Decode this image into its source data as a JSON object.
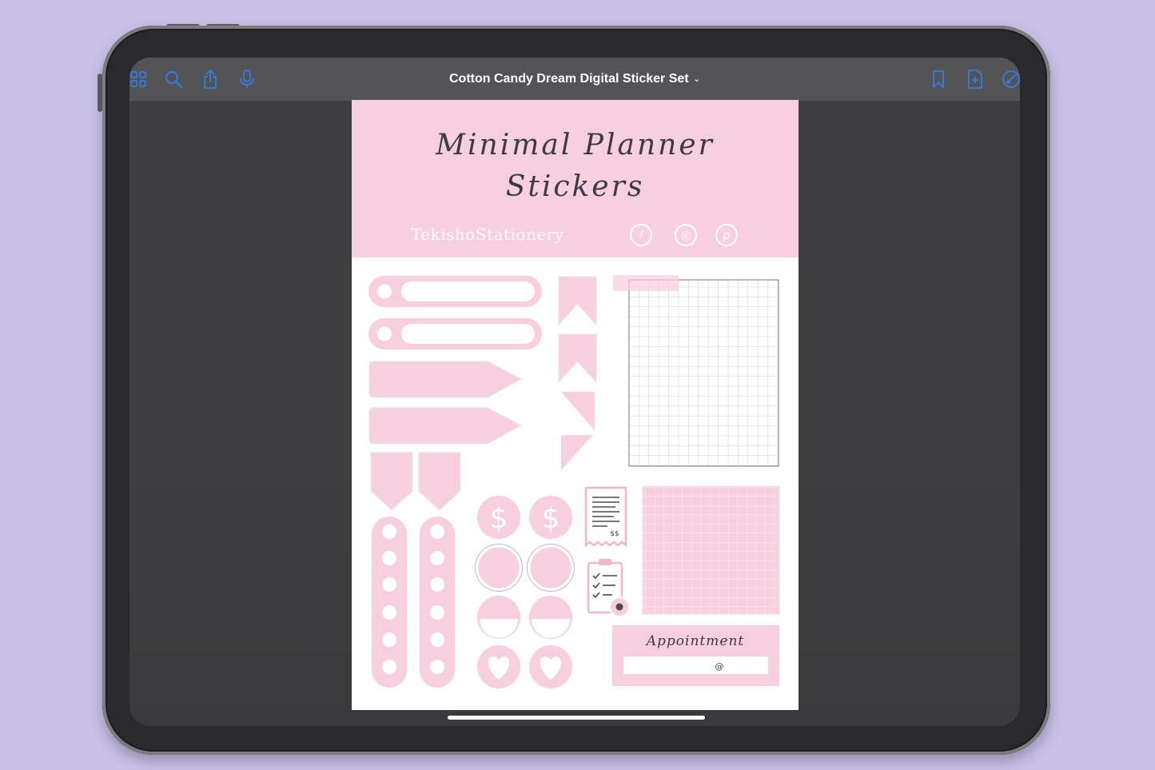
{
  "toolbar": {
    "left_icons": [
      "grid-icon",
      "search-icon",
      "share-icon",
      "microphone-icon"
    ],
    "right_icons": [
      "bookmark-icon",
      "add-page-icon",
      "markup-icon"
    ],
    "title": "Cotton Candy Dream Digital Sticker Set",
    "title_chevron": "⌄"
  },
  "sheet": {
    "title_line1": "Minimal Planner",
    "title_line2": "Stickers",
    "brand": "TekishoStationery",
    "social_icons": [
      "facebook-icon",
      "instagram-icon",
      "pinterest-icon"
    ],
    "social_glyphs": [
      "f",
      "◎",
      "p"
    ],
    "dollar_symbol": "$",
    "appointment_label": "Appointment",
    "appointment_mark": "@",
    "receipt_text": "$$"
  },
  "colors": {
    "background": "#c9c1e6",
    "accent": "#2f7ee6",
    "sticker_pink": "#f8cfdf",
    "toolbar": "#545456",
    "screen": "#3f3f41"
  }
}
